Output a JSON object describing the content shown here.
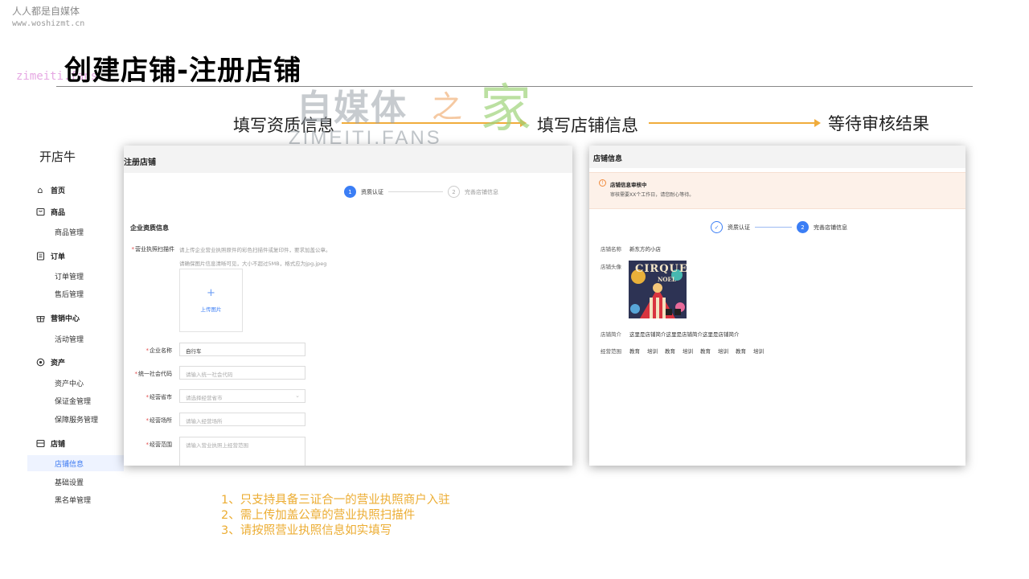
{
  "watermark_top": {
    "name": "人人都是自媒体",
    "url": "www.woshizmt.cn"
  },
  "watermark_left": "zimeiti.fans",
  "watermark_big": {
    "cn": "自媒体",
    "zhi": "之",
    "jia": "家",
    "en": "ZIMEITI.FANS"
  },
  "slide_title": "创建店铺-注册店铺",
  "flow": {
    "steps": [
      "填写资质信息",
      "填写店铺信息",
      "等待审核结果"
    ],
    "arrow_color": "#f0ac3c"
  },
  "sidebar": {
    "brand": "开店牛",
    "groups": [
      {
        "label": "首页",
        "icon": "home-icon",
        "items": []
      },
      {
        "label": "商品",
        "icon": "product-icon",
        "items": [
          "商品管理"
        ]
      },
      {
        "label": "订单",
        "icon": "order-icon",
        "items": [
          "订单管理",
          "售后管理"
        ]
      },
      {
        "label": "营销中心",
        "icon": "gift-icon",
        "items": [
          "活动管理"
        ]
      },
      {
        "label": "资产",
        "icon": "asset-icon",
        "items": [
          "资产中心",
          "保证金管理",
          "保障服务管理"
        ]
      },
      {
        "label": "店铺",
        "icon": "store-icon",
        "items": [
          "店铺信息",
          "基础设置",
          "黑名单管理"
        ]
      }
    ],
    "active_item": "店铺信息",
    "accent_color": "#3a78f2"
  },
  "register_panel": {
    "header": "注册店铺",
    "steps": [
      {
        "num": "1",
        "label": "资质认证",
        "state": "current"
      },
      {
        "num": "2",
        "label": "完善店铺信息",
        "state": "pending"
      }
    ],
    "section_title": "企业资质信息",
    "license": {
      "label": "营业执照扫描件",
      "hint1": "请上传企业营业执照原件的彩色扫描件或复印件，要求加盖公章。",
      "hint2": "请确保图片信息清晰可见，大小不超过5MB，格式应为jpg,jpeg",
      "upload_label": "上传图片"
    },
    "fields": [
      {
        "label": "企业名称",
        "value": "自行车",
        "placeholder": "",
        "type": "text"
      },
      {
        "label": "统一社会代码",
        "value": "",
        "placeholder": "请输入统一社会代码",
        "type": "text"
      },
      {
        "label": "经营省市",
        "value": "",
        "placeholder": "请选择经营省市",
        "type": "select"
      },
      {
        "label": "经营场所",
        "value": "",
        "placeholder": "请输入经营场所",
        "type": "text"
      },
      {
        "label": "经营范围",
        "value": "",
        "placeholder": "请输入营业执照上经营范围",
        "type": "textarea"
      }
    ]
  },
  "store_panel": {
    "header": "店铺信息",
    "notice": {
      "title": "店铺信息审核中",
      "desc": "审核需要XX个工作日，请您耐心等待。"
    },
    "steps": [
      {
        "num": "✓",
        "label": "资质认证",
        "state": "done"
      },
      {
        "num": "2",
        "label": "完善店铺信息",
        "state": "current"
      }
    ],
    "store_name_label": "店铺名称",
    "store_name": "新东方的小店",
    "avatar_label": "店铺头像",
    "avatar_text": {
      "line1": "CIRQUE",
      "line2": "NOEL"
    },
    "intro_label": "店铺简介",
    "intro": "这里是店铺简介这里是店铺简介这里是店铺简介",
    "scope_label": "经营范围",
    "scope_tags": [
      "教育",
      "培训",
      "教育",
      "培训",
      "教育",
      "培训",
      "教育",
      "培训"
    ]
  },
  "notes": [
    "1、只支持具备三证合一的营业执照商户入驻",
    "2、需上传加盖公章的营业执照扫描件",
    "3、请按照营业执照信息如实填写"
  ]
}
